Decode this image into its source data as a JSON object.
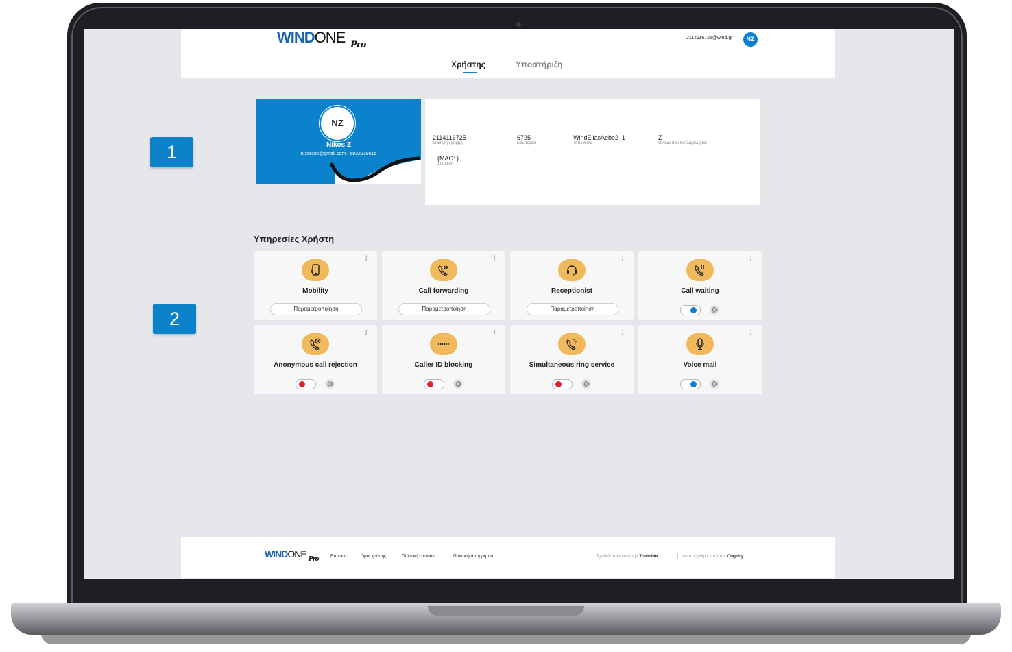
{
  "header": {
    "logo": {
      "wind": "WIND",
      "one": "ONE",
      "pro": "Pro"
    },
    "user_email": "2114116725@wind.gr",
    "user_initials": "NZ",
    "tabs": [
      {
        "label": "Χρήστης",
        "active": true
      },
      {
        "label": "Υποστήριξη",
        "active": false
      }
    ]
  },
  "steps": [
    "1",
    "2"
  ],
  "profile": {
    "initials": "NZ",
    "name": "Nikos Z",
    "contact": "n.zorzos@gmail.com - 6932239515"
  },
  "user_info": {
    "fixed_line": {
      "value": "2114116725",
      "label": "Σταθερή γραμμή"
    },
    "extension": {
      "value": "6725",
      "label": "Εσωτερικό"
    },
    "location": {
      "value": "WindEllasAebe2_1",
      "label": "Τοποθεσία"
    },
    "display_name": {
      "value": "Z",
      "label": "Όνομα που θα εμφανίζεται"
    },
    "device": {
      "value": "(MAC: )",
      "label": "Συσκευή"
    }
  },
  "services": {
    "title": "Υπηρεσίες Χρήστη",
    "info_glyph": "i",
    "configure_label": "Παραμετροποίηση",
    "items": [
      {
        "name": "Mobility",
        "icon": "mobile-phone-icon",
        "control": "button"
      },
      {
        "name": "Call forwarding",
        "icon": "call-forward-icon",
        "control": "button"
      },
      {
        "name": "Receptionist",
        "icon": "headset-icon",
        "control": "button"
      },
      {
        "name": "Call waiting",
        "icon": "call-pause-icon",
        "control": "toggle",
        "enabled": true
      },
      {
        "name": "Anonymous call rejection",
        "icon": "call-reject-icon",
        "control": "toggle",
        "enabled": false
      },
      {
        "name": "Caller ID blocking",
        "icon": "masked-dots-icon",
        "control": "toggle",
        "enabled": false
      },
      {
        "name": "Simultaneous ring service",
        "icon": "call-ring-icon",
        "control": "toggle",
        "enabled": false
      },
      {
        "name": "Voice mail",
        "icon": "microphone-icon",
        "control": "toggle",
        "enabled": true
      }
    ]
  },
  "footer": {
    "logo": {
      "wind": "WIND",
      "one": "ONE",
      "pro": "Pro"
    },
    "links": [
      "Εταιρεία",
      "Όροι χρήσης",
      "Πολιτική cookies",
      "Πολιτική απορρήτου"
    ],
    "designed_by": "Σχεδιάστηκε από την",
    "designer": "Trebbble",
    "developed_by": "Αναπτύχθηκε από την",
    "developer": "Cognity"
  },
  "colors": {
    "brand_blue": "#0b83cc",
    "icon_gold": "#efb95c",
    "toggle_on": "#0a7fd1",
    "toggle_off": "#e0202a",
    "screen_bg": "#e6e7ea"
  }
}
